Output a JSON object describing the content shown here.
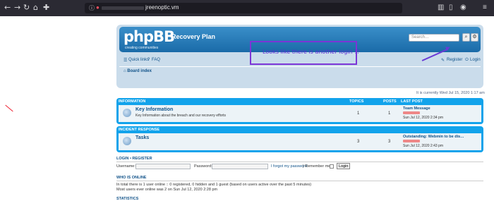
{
  "browser": {
    "url": "jreenoptic.vm"
  },
  "header": {
    "logo_text": "phpBB",
    "logo_sub": "creating communities",
    "site_title": "Recovery Plan",
    "search_placeholder": "Search…"
  },
  "nav": {
    "quick_links": "Quick links",
    "faq": "FAQ",
    "register": "Register",
    "login": "Login",
    "board_index": "Board index"
  },
  "current_time": "It is currently Wed Jul 15, 2020 1:17 am",
  "columns": {
    "topics": "TOPICS",
    "posts": "POSTS",
    "last_post": "LAST POST"
  },
  "categories": [
    {
      "name": "INFORMATION",
      "forum": {
        "name": "Key Information",
        "desc": "Key Information about the breach and our recovery efforts",
        "topics": "1",
        "posts": "1",
        "last_title": "Team Message",
        "last_date": "Sun Jul 12, 2020 2:34 pm"
      }
    },
    {
      "name": "INCIDENT RESPONSE",
      "forum": {
        "name": "Tasks",
        "desc": "",
        "topics": "3",
        "posts": "3",
        "last_title": "Outstanding: Webmin to be dis…",
        "last_date": "Sun Jul 12, 2020 2:43 pm"
      }
    }
  ],
  "login_section": {
    "heading_login": "LOGIN",
    "sep": "•",
    "heading_register": "REGISTER",
    "username_label": "Username:",
    "password_label": "Password:",
    "forgot": "I forgot my password",
    "remember": "Remember me",
    "login_button": "Login"
  },
  "who_is_online": {
    "heading": "WHO IS ONLINE",
    "line1": "In total there is 1 user online :: 0 registered, 0 hidden and 1 guest (based on users active over the past 5 minutes)",
    "line2": "Most users ever online was 2 on Sun Jul 12, 2020 2:28 pm"
  },
  "statistics": {
    "heading": "STATISTICS"
  },
  "annotation": {
    "text": "Looks like there is another login !?",
    "color": "#7b35d6"
  }
}
